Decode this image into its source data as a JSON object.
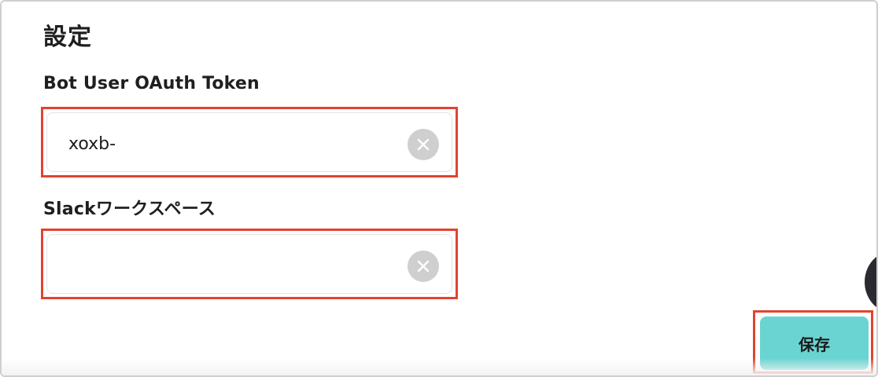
{
  "page": {
    "title": "設定"
  },
  "fields": {
    "token": {
      "label": "Bot User OAuth Token",
      "value": "xoxb-",
      "placeholder": ""
    },
    "workspace": {
      "label": "Slackワークスペース",
      "value": "",
      "placeholder": ""
    }
  },
  "actions": {
    "save_label": "保存"
  },
  "icons": {
    "clear": "close-circle-icon",
    "chat": "chat-launcher-icon"
  },
  "colors": {
    "highlight": "#e0442f",
    "save_button": "#6ad4d2",
    "clear_button": "#cfcfcf",
    "chat_bubble": "#2a2a30"
  }
}
